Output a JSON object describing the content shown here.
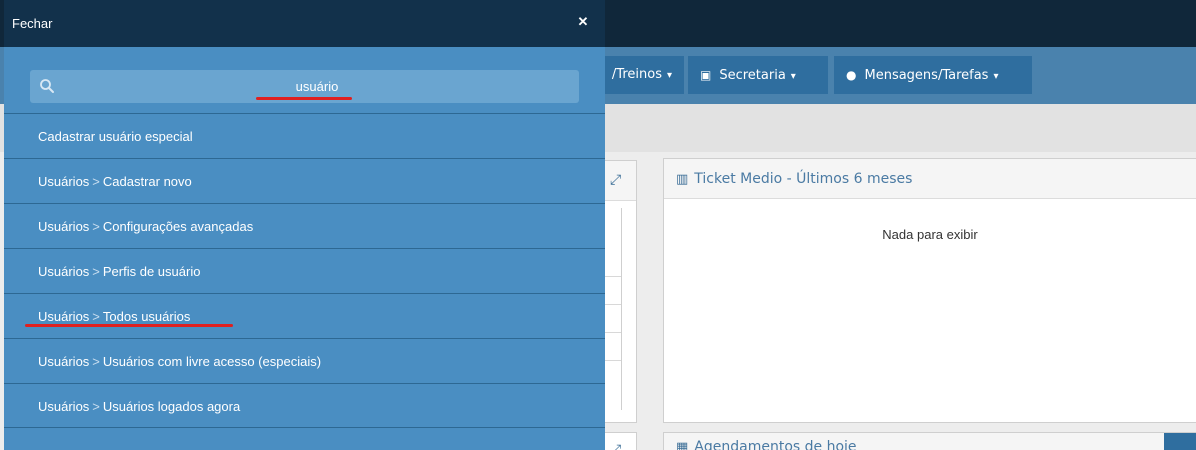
{
  "drawer": {
    "title": "Fechar",
    "close_glyph": "✕",
    "search": {
      "value": "usuário",
      "placeholder": ""
    },
    "separator": ">",
    "results": [
      {
        "parts": [
          "Cadastrar usuário especial"
        ]
      },
      {
        "parts": [
          "Usuários",
          "Cadastrar novo"
        ]
      },
      {
        "parts": [
          "Usuários",
          "Configurações avançadas"
        ]
      },
      {
        "parts": [
          "Usuários",
          "Perfis de usuário"
        ]
      },
      {
        "parts": [
          "Usuários",
          "Todos usuários"
        ]
      },
      {
        "parts": [
          "Usuários",
          "Usuários com livre acesso (especiais)"
        ]
      },
      {
        "parts": [
          "Usuários",
          "Usuários logados agora"
        ]
      }
    ]
  },
  "nav": {
    "treinos_label": "/Treinos",
    "secretaria_label": "Secretaria",
    "mensagens_label": "Mensagens/Tarefas"
  },
  "panels": {
    "ticket": {
      "title": "Ticket Medio - Últimos 6 meses",
      "empty": "Nada para exibir"
    },
    "agendamentos": {
      "title": "Agendamentos de hoje"
    }
  },
  "icons": {
    "search": "search-icon",
    "close": "close-icon",
    "secretaria": "money-icon",
    "mensagens": "chat-icon",
    "ticket": "bar-chart-icon",
    "agendamentos": "calendar-icon",
    "expand": "expand-icon"
  },
  "colors": {
    "drawer_bg": "#4a8ec2",
    "drawer_header": "#12314b",
    "navbar": "#4a82ad",
    "nav_button": "#2f6e9f",
    "highlight_mark": "#e02020"
  }
}
